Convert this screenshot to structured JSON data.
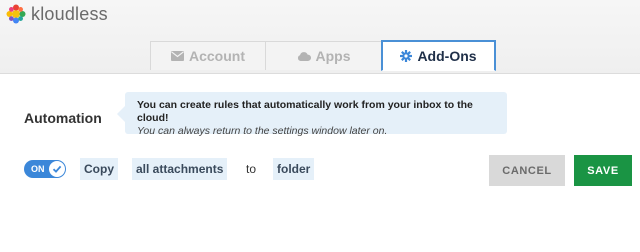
{
  "app": {
    "name": "kloudless"
  },
  "tabs": [
    {
      "label": "Account",
      "icon": "envelope-icon",
      "active": false
    },
    {
      "label": "Apps",
      "icon": "cloud-icon",
      "active": false
    },
    {
      "label": "Add-Ons",
      "icon": "gear-icon",
      "active": true
    }
  ],
  "automation": {
    "label": "Automation",
    "tip_main": "You can create rules that automatically work from your inbox to the cloud!",
    "tip_sub": "You can always return to the settings window later on.",
    "rule": {
      "toggle_label": "ON",
      "action": "Copy",
      "target": "all attachments",
      "connector": "to",
      "destination": "folder"
    }
  },
  "buttons": {
    "cancel": "CANCEL",
    "save": "SAVE"
  },
  "colors": {
    "accent": "#3b87d9",
    "save": "#1a9444",
    "tip_bg": "#e5f0f9"
  }
}
